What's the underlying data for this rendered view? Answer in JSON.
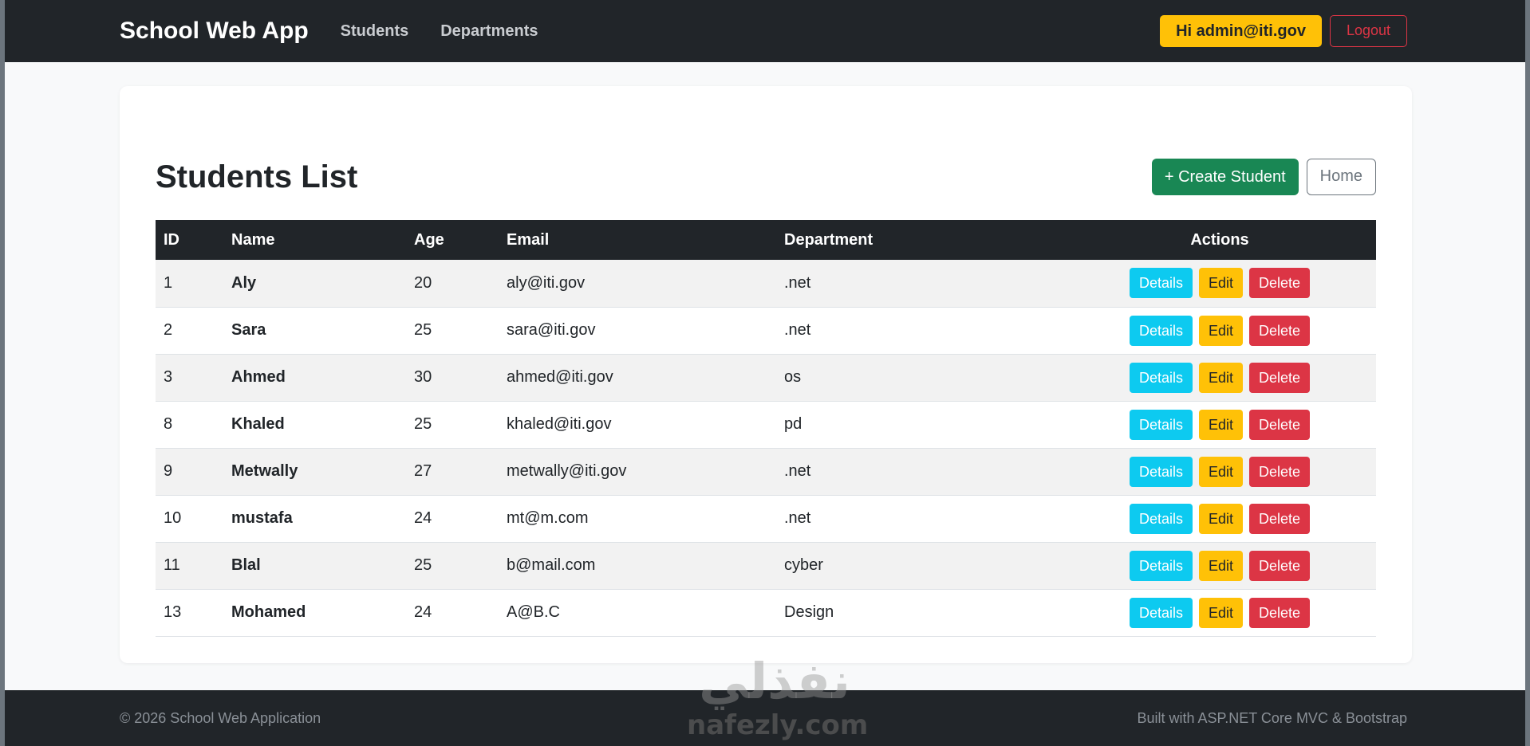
{
  "navbar": {
    "brand": "School Web App",
    "links": [
      "Students",
      "Departments"
    ],
    "greeting": "Hi admin@iti.gov",
    "logout": "Logout"
  },
  "page": {
    "title": "Students List",
    "create_label": "+ Create Student",
    "home_label": "Home"
  },
  "table": {
    "headers": [
      "ID",
      "Name",
      "Age",
      "Email",
      "Department",
      "Actions"
    ],
    "rows": [
      {
        "id": "1",
        "name": "Aly",
        "age": "20",
        "email": "aly@iti.gov",
        "department": ".net"
      },
      {
        "id": "2",
        "name": "Sara",
        "age": "25",
        "email": "sara@iti.gov",
        "department": ".net"
      },
      {
        "id": "3",
        "name": "Ahmed",
        "age": "30",
        "email": "ahmed@iti.gov",
        "department": "os"
      },
      {
        "id": "8",
        "name": "Khaled",
        "age": "25",
        "email": "khaled@iti.gov",
        "department": "pd"
      },
      {
        "id": "9",
        "name": "Metwally",
        "age": "27",
        "email": "metwally@iti.gov",
        "department": ".net"
      },
      {
        "id": "10",
        "name": "mustafa",
        "age": "24",
        "email": "mt@m.com",
        "department": ".net"
      },
      {
        "id": "11",
        "name": "Blal",
        "age": "25",
        "email": "b@mail.com",
        "department": "cyber"
      },
      {
        "id": "13",
        "name": "Mohamed",
        "age": "24",
        "email": "A@B.C",
        "department": "Design"
      }
    ],
    "actions": {
      "details": "Details",
      "edit": "Edit",
      "delete": "Delete"
    }
  },
  "footer": {
    "copyright": "© 2026 School Web Application",
    "built_with": "Built with ASP.NET Core MVC & Bootstrap"
  },
  "watermark": {
    "arabic": "نفذلي",
    "latin": "nafezly.com"
  }
}
